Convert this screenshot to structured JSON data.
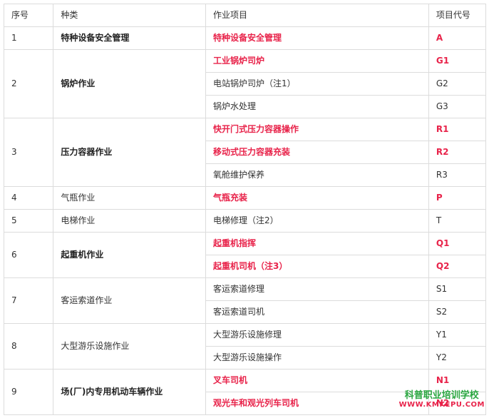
{
  "headers": [
    "序号",
    "种类",
    "作业项目",
    "项目代号"
  ],
  "rows": [
    {
      "no": "1",
      "category": "特种设备安全管理",
      "category_bold": true,
      "items": [
        {
          "name": "特种设备安全管理",
          "code": "A",
          "red": true
        }
      ]
    },
    {
      "no": "2",
      "category": "锅炉作业",
      "category_bold": true,
      "items": [
        {
          "name": "工业锅炉司炉",
          "code": "G1",
          "red": true
        },
        {
          "name": "电站锅炉司炉（注1）",
          "code": "G2",
          "red": false
        },
        {
          "name": "锅炉水处理",
          "code": "G3",
          "red": false
        }
      ]
    },
    {
      "no": "3",
      "category": "压力容器作业",
      "category_bold": true,
      "items": [
        {
          "name": "快开门式压力容器操作",
          "code": "R1",
          "red": true
        },
        {
          "name": "移动式压力容器充装",
          "code": "R2",
          "red": true
        },
        {
          "name": "氧舱维护保养",
          "code": "R3",
          "red": false
        }
      ]
    },
    {
      "no": "4",
      "category": "气瓶作业",
      "category_bold": false,
      "items": [
        {
          "name": "气瓶充装",
          "code": "P",
          "red": true
        }
      ]
    },
    {
      "no": "5",
      "category": "电梯作业",
      "category_bold": false,
      "items": [
        {
          "name": "电梯修理（注2）",
          "code": "T",
          "red": false
        }
      ]
    },
    {
      "no": "6",
      "category": "起重机作业",
      "category_bold": true,
      "items": [
        {
          "name": "起重机指挥",
          "code": "Q1",
          "red": true
        },
        {
          "name": "起重机司机（注3）",
          "code": "Q2",
          "red": true
        }
      ]
    },
    {
      "no": "7",
      "category": "客运索道作业",
      "category_bold": false,
      "items": [
        {
          "name": "客运索道修理",
          "code": "S1",
          "red": false
        },
        {
          "name": "客运索道司机",
          "code": "S2",
          "red": false
        }
      ]
    },
    {
      "no": "8",
      "category": "大型游乐设施作业",
      "category_bold": false,
      "items": [
        {
          "name": "大型游乐设施修理",
          "code": "Y1",
          "red": false
        },
        {
          "name": "大型游乐设施操作",
          "code": "Y2",
          "red": false
        }
      ]
    },
    {
      "no": "9",
      "category": "场(厂)内专用机动车辆作业",
      "category_bold": true,
      "items": [
        {
          "name": "叉车司机",
          "code": "N1",
          "red": true
        },
        {
          "name": "观光车和观光列车司机",
          "code": "N2",
          "red": true
        }
      ]
    }
  ],
  "watermark": {
    "name": "科普职业培训学校",
    "url": "WWW.KMKEPU.COM"
  }
}
